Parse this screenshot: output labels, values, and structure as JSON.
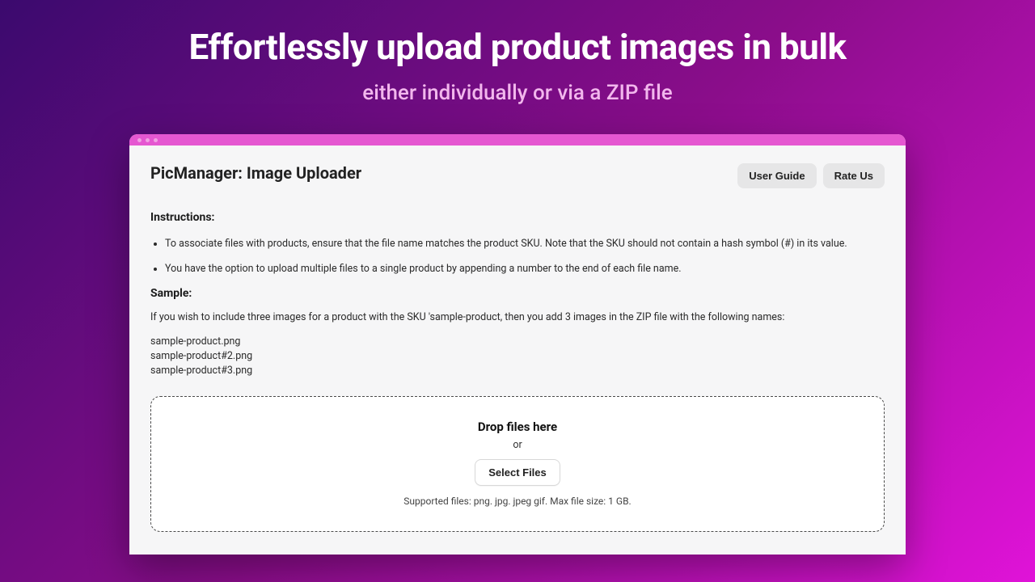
{
  "hero": {
    "title": "Effortlessly upload product images in bulk",
    "subtitle": "either individually or via a ZIP file"
  },
  "header": {
    "appTitle": "PicManager: Image Uploader",
    "buttons": {
      "userGuide": "User Guide",
      "rateUs": "Rate Us"
    }
  },
  "instructions": {
    "label": "Instructions:",
    "items": [
      "To associate files with products, ensure that the file name matches the product SKU. Note that the SKU should not contain a hash symbol (#) in its value.",
      "You have the option to upload multiple files to a single product by appending a number to the end of each file name."
    ]
  },
  "sample": {
    "label": "Sample:",
    "description": "If you wish to include three images for a product with the SKU 'sample-product, then you add 3 images in the ZIP file with the following names:",
    "files": [
      "sample-product.png",
      "sample-product#2.png",
      "sample-product#3.png"
    ]
  },
  "dropzone": {
    "title": "Drop files here",
    "or": "or",
    "selectButton": "Select Files",
    "supported": "Supported files: png. jpg. jpeg gif. Max file size: 1 GB."
  }
}
